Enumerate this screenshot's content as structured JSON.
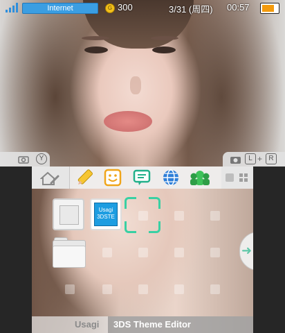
{
  "status": {
    "connection_label": "Internet",
    "coin_symbol": "G",
    "coin_count": "300",
    "date": "3/31 (周四)",
    "time": "00:57",
    "battery_level": 0.85,
    "signal_bars": 4
  },
  "top_tabs": {
    "left_button": "Y",
    "right_buttons": [
      "L",
      "+",
      "R"
    ]
  },
  "toolbar": {
    "icons": [
      "home-settings-icon",
      "pencil-icon",
      "miiverse-smile-icon",
      "notification-speech-icon",
      "internet-globe-icon",
      "friends-icon",
      "view-small-icon",
      "view-grid-icon"
    ]
  },
  "apps": {
    "usagi_tile_line1": "Usagi",
    "usagi_tile_line2": "3DSTE"
  },
  "bottom_bar": {
    "left_text": "Usagi",
    "right_text": "3DS Theme Editor"
  },
  "colors": {
    "accent": "#3b9ee2",
    "cursor": "#39d0a3",
    "battery": "#f39a0c"
  }
}
